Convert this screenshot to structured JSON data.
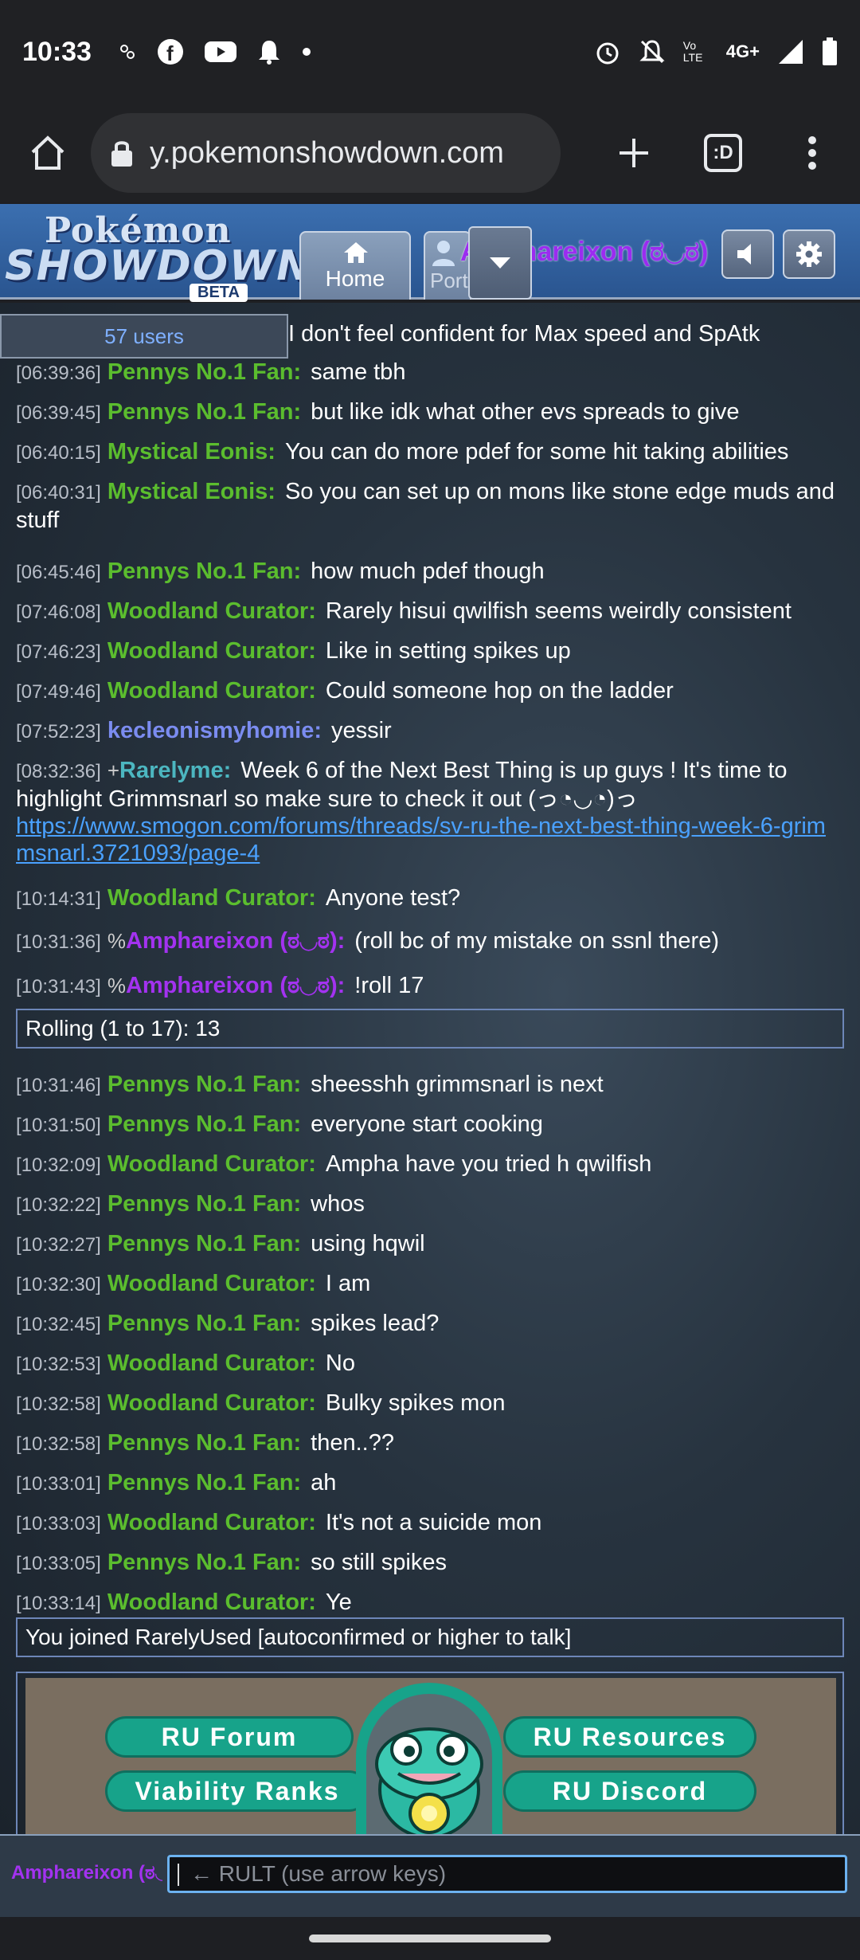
{
  "status_bar": {
    "time": "10:33",
    "network": "4G+",
    "volte_label": "Vo LTE"
  },
  "browser": {
    "url": "y.pokemonshowdown.com",
    "tab_count": ":D"
  },
  "header": {
    "logo_line1": "Pokémon",
    "logo_line2": "SHOWDOWN!",
    "logo_badge": "BETA",
    "home_tab_label": "Home",
    "room_tab_label": "Port",
    "username": "Amphareixon (ಠ◡ಠ)"
  },
  "userlist": {
    "label": "57 users"
  },
  "chat": {
    "partial_first_line": "I don't feel confident for Max speed and SpAtk",
    "messages": [
      {
        "time": "[06:39:36]",
        "group": "",
        "user": "Pennys No.1 Fan:",
        "color": "green",
        "text": "same tbh"
      },
      {
        "time": "[06:39:45]",
        "group": "",
        "user": "Pennys No.1 Fan:",
        "color": "green",
        "text": "but like idk what other evs spreads to give"
      },
      {
        "time": "[06:40:15]",
        "group": "",
        "user": "Mystical Eonis:",
        "color": "green",
        "text": "You can do more pdef for some hit taking abilities"
      },
      {
        "time": "[06:40:31]",
        "group": "",
        "user": "Mystical Eonis:",
        "color": "green",
        "text": "So you can set up on mons like stone edge muds and stuff"
      },
      {
        "time": "[06:45:46]",
        "group": "",
        "user": "Pennys No.1 Fan:",
        "color": "green",
        "text": "how much pdef though"
      },
      {
        "time": "[07:46:08]",
        "group": "",
        "user": "Woodland Curator:",
        "color": "green",
        "text": "Rarely hisui qwilfish seems weirdly consistent"
      },
      {
        "time": "[07:46:23]",
        "group": "",
        "user": "Woodland Curator:",
        "color": "green",
        "text": "Like in setting spikes up"
      },
      {
        "time": "[07:49:46]",
        "group": "",
        "user": "Woodland Curator:",
        "color": "green",
        "text": "Could someone hop on the ladder"
      },
      {
        "time": "[07:52:23]",
        "group": "",
        "user": "kecleonismyhomie:",
        "color": "blue",
        "text": "yessir"
      },
      {
        "time": "[08:32:36]",
        "group": "+",
        "user": "Rarelyme:",
        "color": "teal",
        "text": "Week 6 of the Next Best Thing is up guys ! It's time to highlight Grimmsnarl so make sure to check it out (っ◔◡◔)っ",
        "link": "https://www.smogon.com/forums/threads/sv-ru-the-next-best-thing-week-6-grimmsnarl.3721093/page-4"
      },
      {
        "time": "[10:14:31]",
        "group": "",
        "user": "Woodland Curator:",
        "color": "green",
        "text": "Anyone test?"
      },
      {
        "time": "[10:31:36]",
        "group": "%",
        "user": "Amphareixon (ಠ◡ಠ):",
        "color": "purple",
        "text": "(roll bc of my mistake on ssnl there)"
      },
      {
        "time": "[10:31:43]",
        "group": "%",
        "user": "Amphareixon (ಠ◡ಠ):",
        "color": "purple",
        "text": "!roll 17"
      },
      {
        "time": "[10:31:46]",
        "group": "",
        "user": "Pennys No.1 Fan:",
        "color": "green",
        "text": "sheesshh grimmsnarl is next"
      },
      {
        "time": "[10:31:50]",
        "group": "",
        "user": "Pennys No.1 Fan:",
        "color": "green",
        "text": "everyone start cooking"
      },
      {
        "time": "[10:32:09]",
        "group": "",
        "user": "Woodland Curator:",
        "color": "green",
        "text": "Ampha have you tried h qwilfish"
      },
      {
        "time": "[10:32:22]",
        "group": "",
        "user": "Pennys No.1 Fan:",
        "color": "green",
        "text": "whos"
      },
      {
        "time": "[10:32:27]",
        "group": "",
        "user": "Pennys No.1 Fan:",
        "color": "green",
        "text": "using hqwil"
      },
      {
        "time": "[10:32:30]",
        "group": "",
        "user": "Woodland Curator:",
        "color": "green",
        "text": "I am"
      },
      {
        "time": "[10:32:45]",
        "group": "",
        "user": "Pennys No.1 Fan:",
        "color": "green",
        "text": "spikes lead?"
      },
      {
        "time": "[10:32:53]",
        "group": "",
        "user": "Woodland Curator:",
        "color": "green",
        "text": "No"
      },
      {
        "time": "[10:32:58]",
        "group": "",
        "user": "Woodland Curator:",
        "color": "green",
        "text": "Bulky spikes mon"
      },
      {
        "time": "[10:32:58]",
        "group": "",
        "user": "Pennys No.1 Fan:",
        "color": "green",
        "text": "then..??"
      },
      {
        "time": "[10:33:01]",
        "group": "",
        "user": "Pennys No.1 Fan:",
        "color": "green",
        "text": "ah"
      },
      {
        "time": "[10:33:03]",
        "group": "",
        "user": "Woodland Curator:",
        "color": "green",
        "text": "It's not a suicide mon"
      },
      {
        "time": "[10:33:05]",
        "group": "",
        "user": "Pennys No.1 Fan:",
        "color": "green",
        "text": "so still spikes"
      },
      {
        "time": "[10:33:14]",
        "group": "",
        "user": "Woodland Curator:",
        "color": "green",
        "text": "Ye"
      }
    ],
    "roll_result": "Rolling (1 to 17): 13",
    "join_notice": "You joined RarelyUsed [autoconfirmed or higher to talk]"
  },
  "banner": {
    "ru_forum": "RU Forum",
    "ru_resources": "RU Resources",
    "viability_ranks": "Viability Ranks",
    "ru_discord": "RU Discord"
  },
  "composer": {
    "name": "Amphareixon (ಠ◡ಠ)",
    "placeholder": "← RULT (use arrow keys)"
  },
  "colors": {
    "green_user": "#5bbd2e",
    "blue_user": "#7b8cf0",
    "teal_user": "#4cb6c0",
    "purple_user": "#a332f0",
    "link": "#4aa1ff"
  }
}
